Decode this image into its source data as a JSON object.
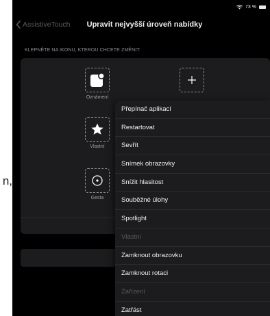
{
  "outside": {
    "fragment": "n,"
  },
  "status_bar": {
    "battery": "73 %"
  },
  "nav": {
    "back_label": "AssistiveTouch",
    "title": "Upravit nejvyšší úroveň nabídky"
  },
  "section_header": "KLEPNĚTE NA IKONU, KTEROU CHCETE ZMĚNIT:",
  "slots": [
    {
      "label": "Oznámení",
      "icon": "notification-icon"
    },
    {
      "label": "",
      "icon": "plus-icon"
    },
    {
      "label": "Vlastní",
      "icon": "star-icon"
    },
    {
      "label": "Gesta",
      "icon": "circle-gesture-icon"
    }
  ],
  "menu": {
    "items": [
      {
        "label": "Přepínač aplikací",
        "enabled": true
      },
      {
        "label": "Restartovat",
        "enabled": true
      },
      {
        "label": "Sevřít",
        "enabled": true
      },
      {
        "label": "Snímek obrazovky",
        "enabled": true
      },
      {
        "label": "Snížit hlasitost",
        "enabled": true
      },
      {
        "label": "Souběžné úlohy",
        "enabled": true
      },
      {
        "label": "Spotlight",
        "enabled": true
      },
      {
        "label": "Vlastní",
        "enabled": false
      },
      {
        "label": "Zamknout obrazovku",
        "enabled": true
      },
      {
        "label": "Zamknout rotaci",
        "enabled": true
      },
      {
        "label": "Zařízení",
        "enabled": false
      },
      {
        "label": "Zatřást",
        "enabled": true
      }
    ]
  },
  "colors": {
    "background": "#000000",
    "panel": "#1c1c1e",
    "text": "#f2f2f2",
    "muted": "#8e8e93",
    "disabled": "#5a5a5e"
  }
}
